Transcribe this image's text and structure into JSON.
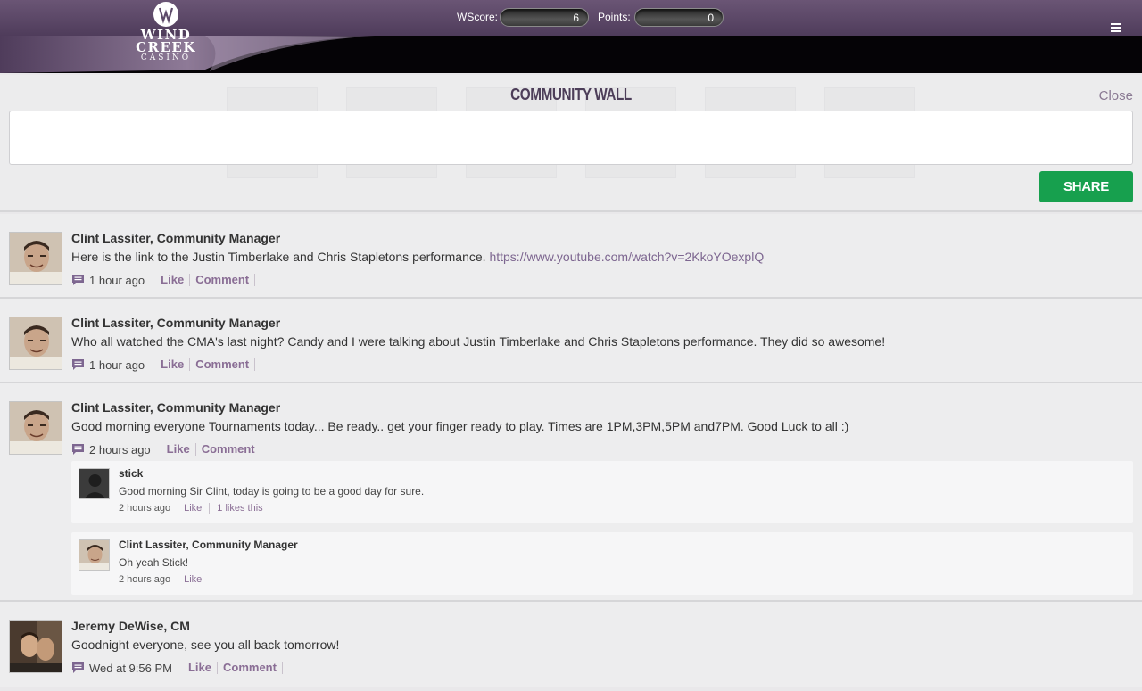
{
  "header": {
    "logo_name": "WIND CREEK",
    "logo_sub": "CASINO",
    "wscore_label": "WScore:",
    "wscore_value": "6",
    "points_label": "Points:",
    "points_value": "0"
  },
  "compose": {
    "title": "COMMUNITY WALL",
    "close_label": "Close",
    "input_value": "",
    "share_label": "SHARE"
  },
  "posts": [
    {
      "author": "Clint Lassiter, Community Manager",
      "text": "Here is the link to the  Justin Timberlake and Chris Stapletons performance. ",
      "link": "https://www.youtube.com/watch?v=2KkoYOexplQ",
      "time": "1 hour ago",
      "like_label": "Like",
      "comment_label": "Comment"
    },
    {
      "author": "Clint Lassiter, Community Manager",
      "text": "Who all watched the CMA's last night? Candy and I were talking about Justin Timberlake and Chris Stapletons performance. They did so awesome!",
      "time": "1 hour ago",
      "like_label": "Like",
      "comment_label": "Comment"
    },
    {
      "author": "Clint Lassiter, Community Manager",
      "text": "Good morning everyone Tournaments today... Be ready.. get your finger ready to play. Times are 1PM,3PM,5PM and7PM. Good Luck to all :)",
      "time": "2 hours ago",
      "like_label": "Like",
      "comment_label": "Comment",
      "replies": [
        {
          "author": "stick",
          "text": "Good morning Sir Clint, today is going to be a good day for sure.",
          "time": "2 hours ago",
          "like_label": "Like",
          "likes_text": "1 likes this"
        },
        {
          "author": "Clint Lassiter, Community Manager",
          "text": "Oh yeah Stick!",
          "time": "2 hours ago",
          "like_label": "Like"
        }
      ]
    },
    {
      "author": "Jeremy DeWise, CM",
      "text": "Goodnight everyone, see you all back tomorrow!",
      "time": "Wed at 9:56 PM",
      "like_label": "Like",
      "comment_label": "Comment"
    }
  ],
  "colors": {
    "header_bar": "#5d4a69",
    "title": "#4d3e59",
    "accent_link": "#8a6e95",
    "share_button": "#17a04e"
  }
}
